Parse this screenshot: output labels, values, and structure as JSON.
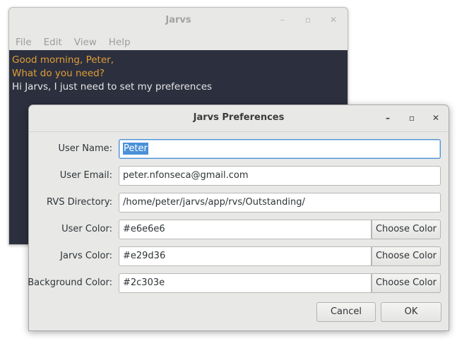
{
  "main_window": {
    "title": "Jarvs",
    "controls": {
      "minimize": "–",
      "maximize": "▫",
      "close": "✕"
    },
    "menu": [
      "File",
      "Edit",
      "View",
      "Help"
    ],
    "console": {
      "lines": [
        {
          "speaker": "jarvs",
          "text": "Good morning, Peter,"
        },
        {
          "speaker": "jarvs",
          "text": "What do you need?"
        },
        {
          "speaker": "user",
          "text": "Hi Jarvs, I just need to set my preferences"
        }
      ],
      "colors": {
        "user": "#e6e6e6",
        "jarvs": "#e29d36",
        "background": "#2c303e"
      }
    }
  },
  "dialog": {
    "title": "Jarvs Preferences",
    "controls": {
      "minimize": "–",
      "maximize": "▫",
      "close": "✕"
    },
    "fields": {
      "user_name": {
        "label": "User Name:",
        "value": "Peter"
      },
      "user_email": {
        "label": "User Email:",
        "value": "peter.nfonseca@gmail.com"
      },
      "rvs_directory": {
        "label": "RVS Directory:",
        "value": "/home/peter/jarvs/app/rvs/Outstanding/"
      },
      "user_color": {
        "label": "User Color:",
        "value": "#e6e6e6"
      },
      "jarvs_color": {
        "label": "Jarvs Color:",
        "value": "#e29d36"
      },
      "background_color": {
        "label": "Background Color:",
        "value": "#2c303e"
      }
    },
    "choose_color_label": "Choose Color",
    "cancel_label": "Cancel",
    "ok_label": "OK"
  }
}
